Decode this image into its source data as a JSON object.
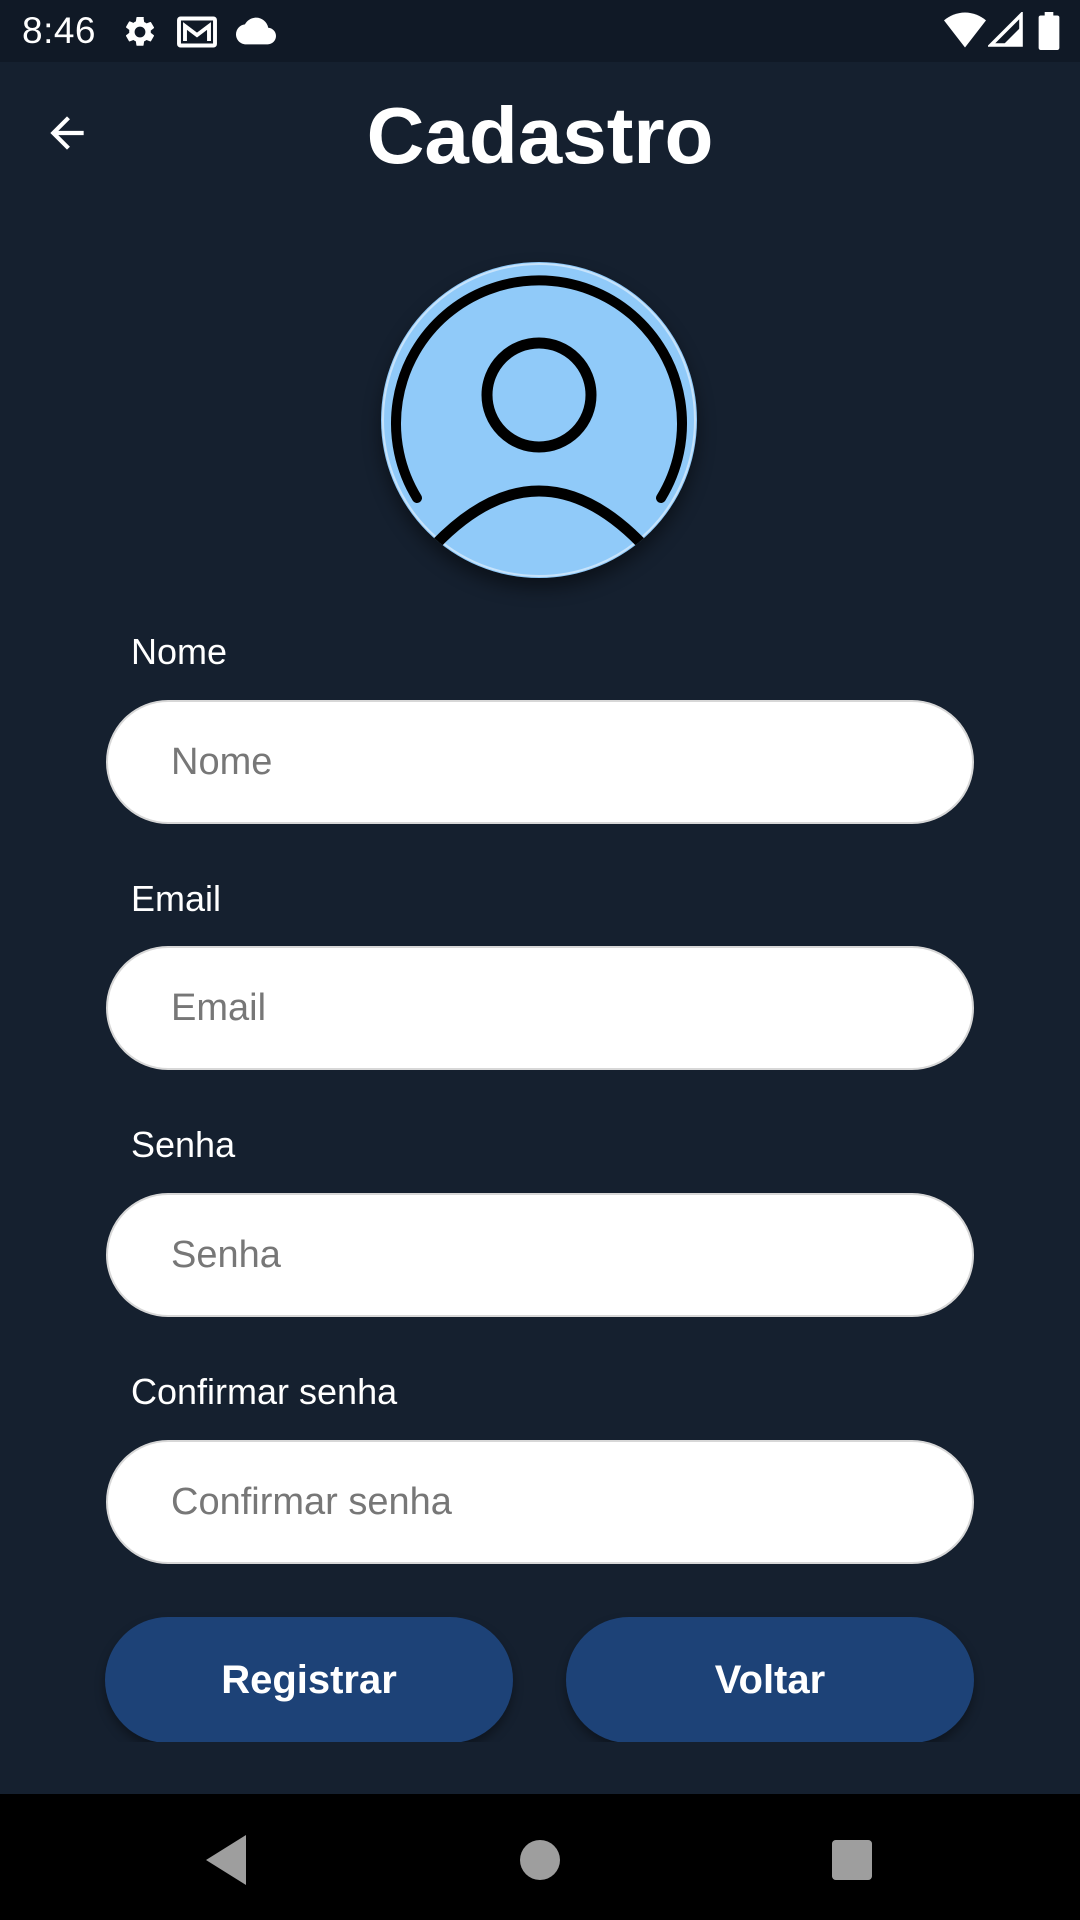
{
  "status_bar": {
    "time": "8:46",
    "left_icons": [
      "gear-icon",
      "gmail-icon",
      "cloud-icon"
    ],
    "right_icons": [
      "wifi-icon",
      "cellular-signal-icon",
      "battery-icon"
    ]
  },
  "header": {
    "title": "Cadastro",
    "back_icon": "arrow-back-icon"
  },
  "avatar": {
    "icon": "account-circle-icon",
    "background_color": "#90caf9"
  },
  "form": {
    "fields": [
      {
        "label": "Nome",
        "placeholder": "Nome",
        "value": ""
      },
      {
        "label": "Email",
        "placeholder": "Email",
        "value": ""
      },
      {
        "label": "Senha",
        "placeholder": "Senha",
        "value": ""
      },
      {
        "label": "Confirmar senha",
        "placeholder": "Confirmar senha",
        "value": ""
      }
    ]
  },
  "actions": {
    "register_label": "Registrar",
    "back_label": "Voltar"
  },
  "nav_bar": {
    "icons": [
      "nav-back-icon",
      "nav-home-icon",
      "nav-recents-icon"
    ]
  },
  "colors": {
    "background": "#15202f",
    "status_bar": "#101926",
    "button": "#1d4277",
    "avatar": "#90caf9"
  }
}
